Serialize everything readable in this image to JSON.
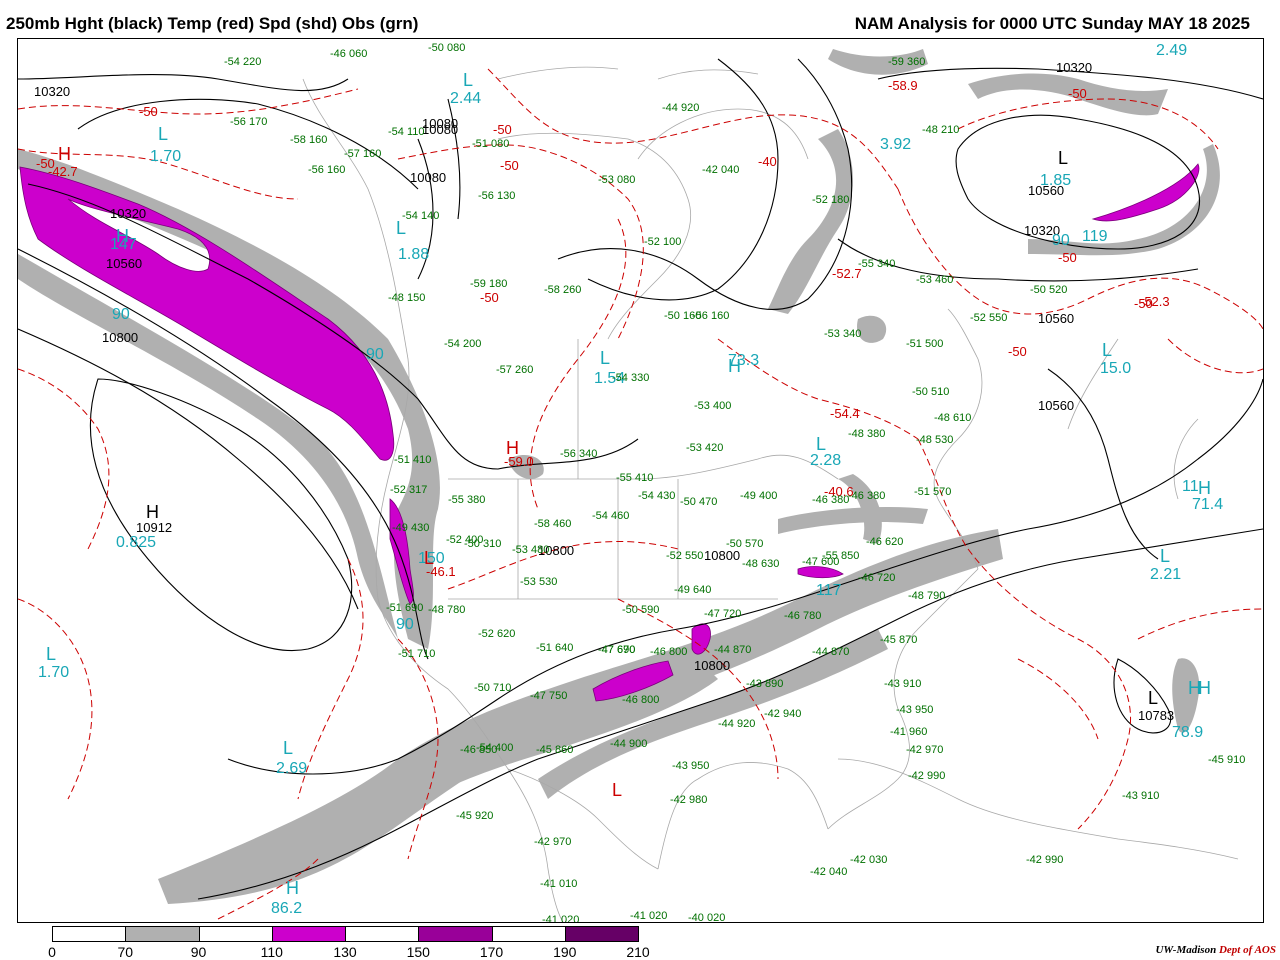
{
  "header": {
    "title_left": "250mb Hght (black) Temp (red) Spd (shd) Obs (grn)",
    "title_right": "NAM Analysis for 0000 UTC Sunday  MAY 18 2025"
  },
  "map": {
    "colors": {
      "height": "#000000",
      "temp": "#cc0000",
      "speed_label": "#19a7b6",
      "obs": "#007000",
      "shade_70_90": "#b0b0b0",
      "shade_110_130": "#cc00cc",
      "shade_150_170": "#990099"
    },
    "height_labels": [
      "10320",
      "10080",
      "10080",
      "10080",
      "10320",
      "10560",
      "10800",
      "10912",
      "10320",
      "10560",
      "10320",
      "10560",
      "10560",
      "10800",
      "10800",
      "10783",
      "10800"
    ],
    "temp_labels": [
      "-50",
      "-50",
      "-50",
      "-40",
      "-50",
      "-50",
      "-50",
      "-50",
      "-50",
      "-50",
      "-42.7",
      "-59.0",
      "-54.4",
      "-52.3",
      "-46.1",
      "-58.9",
      "-52.7",
      "-40.6"
    ],
    "speed_labels": [
      "2.44",
      "1.70",
      "147",
      "90",
      "90",
      "1.88",
      "1.54",
      "73.3",
      "2.28",
      "0.825",
      "1.70",
      "2.69",
      "86.2",
      "150",
      "90",
      "117",
      "71.4",
      "2.21",
      "78.9",
      "15.0",
      "3.92",
      "2.49",
      "1.85",
      "90",
      "119",
      "11"
    ],
    "centers": [
      "L",
      "L",
      "H",
      "H",
      "L",
      "L",
      "L",
      "H",
      "L",
      "H",
      "H",
      "L",
      "L",
      "H",
      "L",
      "L",
      "H",
      "L",
      "H",
      "L",
      "H",
      "L"
    ],
    "obs_samples": [
      {
        "t": "-54",
        "h": "220"
      },
      {
        "t": "-46",
        "h": "060"
      },
      {
        "t": "-50",
        "h": "080"
      },
      {
        "t": "-56",
        "h": "170"
      },
      {
        "t": "-58",
        "h": "160"
      },
      {
        "t": "-57",
        "h": "160"
      },
      {
        "t": "-54",
        "h": "110"
      },
      {
        "t": "-56",
        "h": "160"
      },
      {
        "t": "-51",
        "h": "080"
      },
      {
        "t": "-53",
        "h": "080"
      },
      {
        "t": "-42",
        "h": "040"
      },
      {
        "t": "-44",
        "h": "920"
      },
      {
        "t": "-56",
        "h": "130"
      },
      {
        "t": "-54",
        "h": "140"
      },
      {
        "t": "-52",
        "h": "100"
      },
      {
        "t": "-50",
        "h": "160"
      },
      {
        "t": "-52",
        "h": "180"
      },
      {
        "t": "-59",
        "h": "360"
      },
      {
        "t": "-48",
        "h": "210"
      },
      {
        "t": "-55",
        "h": "340"
      },
      {
        "t": "-53",
        "h": "460"
      },
      {
        "t": "-50",
        "h": "520"
      },
      {
        "t": "-52",
        "h": "550"
      },
      {
        "t": "-53",
        "h": "340"
      },
      {
        "t": "-51",
        "h": "500"
      },
      {
        "t": "-59",
        "h": "180"
      },
      {
        "t": "-58",
        "h": "260"
      },
      {
        "t": "-56",
        "h": "160"
      },
      {
        "t": "-48",
        "h": "150"
      },
      {
        "t": "-54",
        "h": "200"
      },
      {
        "t": "-57",
        "h": "260"
      },
      {
        "t": "-54",
        "h": "330"
      },
      {
        "t": "-53",
        "h": "400"
      },
      {
        "t": "-50",
        "h": "510"
      },
      {
        "t": "-48",
        "h": "610"
      },
      {
        "t": "-48",
        "h": "380"
      },
      {
        "t": "-48",
        "h": "530"
      },
      {
        "t": "-53",
        "h": "420"
      },
      {
        "t": "-56",
        "h": "340"
      },
      {
        "t": "-55",
        "h": "410"
      },
      {
        "t": "-54",
        "h": "430"
      },
      {
        "t": "-50",
        "h": "470"
      },
      {
        "t": "-49",
        "h": "400"
      },
      {
        "t": "-46",
        "h": "380"
      },
      {
        "t": "-46",
        "h": "380"
      },
      {
        "t": "-51",
        "h": "570"
      },
      {
        "t": "-55",
        "h": "380"
      },
      {
        "t": "-58",
        "h": "460"
      },
      {
        "t": "-54",
        "h": "460"
      },
      {
        "t": "-52",
        "h": "400"
      },
      {
        "t": "-53",
        "h": "480"
      },
      {
        "t": "-52",
        "h": "550"
      },
      {
        "t": "-50",
        "h": "570"
      },
      {
        "t": "-48",
        "h": "630"
      },
      {
        "t": "-47",
        "h": "600"
      },
      {
        "t": "-46",
        "h": "620"
      },
      {
        "t": "-46",
        "h": "720"
      },
      {
        "t": "-48",
        "h": "790"
      },
      {
        "t": "-53",
        "h": "530"
      },
      {
        "t": "-50",
        "h": "590"
      },
      {
        "t": "-47",
        "h": "720"
      },
      {
        "t": "-49",
        "h": "640"
      },
      {
        "t": "-46",
        "h": "780"
      },
      {
        "t": "-45",
        "h": "870"
      },
      {
        "t": "-44",
        "h": "870"
      },
      {
        "t": "-47",
        "h": "690"
      },
      {
        "t": "-48",
        "h": "780"
      },
      {
        "t": "-52",
        "h": "620"
      },
      {
        "t": "-51",
        "h": "640"
      },
      {
        "t": "-47",
        "h": "670"
      },
      {
        "t": "-46",
        "h": "800"
      },
      {
        "t": "-44",
        "h": "870"
      },
      {
        "t": "-43",
        "h": "890"
      },
      {
        "t": "-43",
        "h": "910"
      },
      {
        "t": "-43",
        "h": "950"
      },
      {
        "t": "-42",
        "h": "940"
      },
      {
        "t": "-41",
        "h": "960"
      },
      {
        "t": "-42",
        "h": "970"
      },
      {
        "t": "-42",
        "h": "990"
      },
      {
        "t": "-50",
        "h": "710"
      },
      {
        "t": "-47",
        "h": "750"
      },
      {
        "t": "-46",
        "h": "800"
      },
      {
        "t": "-44",
        "h": "900"
      },
      {
        "t": "-46",
        "h": "850"
      },
      {
        "t": "-45",
        "h": "860"
      },
      {
        "t": "-43",
        "h": "950"
      },
      {
        "t": "-44",
        "h": "920"
      },
      {
        "t": "-42",
        "h": "980"
      },
      {
        "t": "-45",
        "h": "920"
      },
      {
        "t": "-42",
        "h": "970"
      },
      {
        "t": "-41",
        "h": "010"
      },
      {
        "t": "-41",
        "h": "020"
      },
      {
        "t": "-41",
        "h": "020"
      },
      {
        "t": "-40",
        "h": "020"
      },
      {
        "t": "-42",
        "h": "040"
      },
      {
        "t": "-42",
        "h": "030"
      },
      {
        "t": "-42",
        "h": "990"
      },
      {
        "t": "-43",
        "h": "910"
      },
      {
        "t": "-45",
        "h": "910"
      },
      {
        "t": "-51",
        "h": "690"
      },
      {
        "t": "-51",
        "h": "710"
      },
      {
        "t": "-49",
        "h": "430"
      },
      {
        "t": "-51",
        "h": "410"
      },
      {
        "t": "-52",
        "h": "317"
      },
      {
        "t": "-50",
        "h": "310"
      },
      {
        "t": "-54",
        "h": "400"
      },
      {
        "t": "-55",
        "h": "850"
      },
      {
        "t": "-47",
        "h": "600"
      }
    ]
  },
  "legend": {
    "labels": [
      "0",
      "70",
      "90",
      "110",
      "130",
      "150",
      "170",
      "190",
      "210"
    ],
    "colors": [
      "#ffffff",
      "#b0b0b0",
      "#ffffff",
      "#cc00cc",
      "#ffffff",
      "#990099",
      "#ffffff",
      "#660066"
    ]
  },
  "credit": {
    "org": "UW-Madison",
    "dept": "Dept of AOS"
  }
}
